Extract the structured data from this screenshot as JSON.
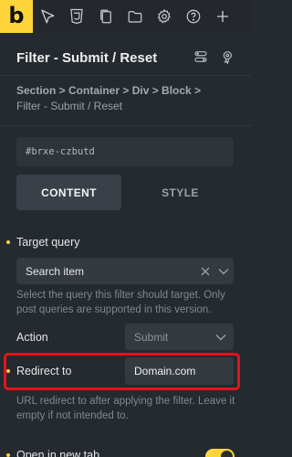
{
  "toolbar": {
    "logo": "b",
    "icons": [
      "cursor-icon",
      "css3-icon",
      "pages-icon",
      "folder-icon",
      "gear-icon",
      "help-icon",
      "plus-icon"
    ]
  },
  "header": {
    "title": "Filter - Submit / Reset"
  },
  "breadcrumb": {
    "path": "Section > Container > Div > Block >",
    "current": "Filter - Submit / Reset"
  },
  "element_id": "#brxe-czbutd",
  "tabs": [
    {
      "label": "CONTENT",
      "active": true
    },
    {
      "label": "STYLE",
      "active": false
    }
  ],
  "controls": {
    "target_query": {
      "label": "Target query",
      "value": "Search item",
      "help": "Select the query this filter should target. Only post queries are supported in this version."
    },
    "action": {
      "label": "Action",
      "value": "Submit"
    },
    "redirect_to": {
      "label": "Redirect to",
      "value": "Domain.com",
      "help": "URL redirect to after applying the filter. Leave it empty if not intended to."
    },
    "open_in_new_tab": {
      "label": "Open in new tab",
      "enabled": true
    }
  },
  "colors": {
    "accent": "#ffd43b",
    "background": "#252a2f",
    "highlight": "#e1141e"
  }
}
